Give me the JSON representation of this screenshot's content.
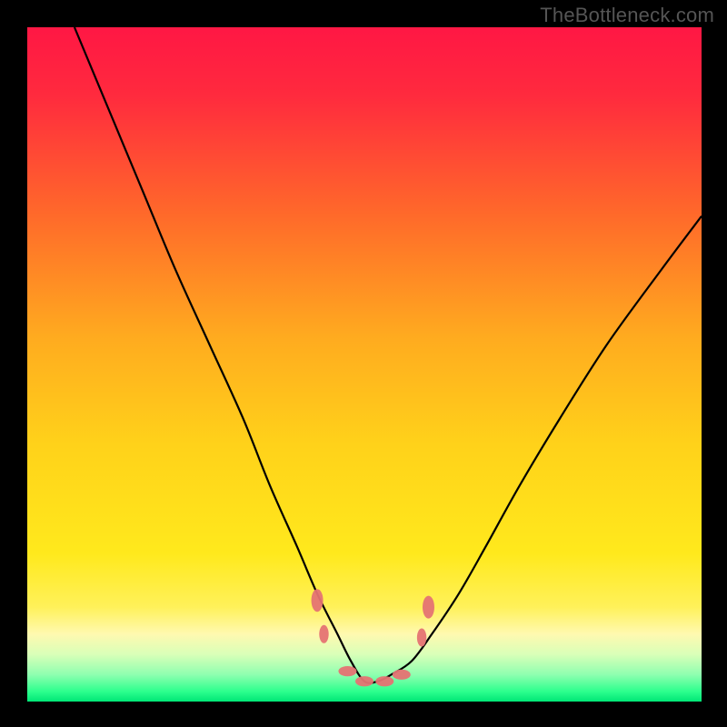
{
  "credit": "TheBottleneck.com",
  "chart_data": {
    "type": "line",
    "title": "",
    "xlabel": "",
    "ylabel": "",
    "xlim": [
      0,
      100
    ],
    "ylim": [
      0,
      100
    ],
    "gradient_stops": [
      {
        "offset": 0.0,
        "color": "#ff1744"
      },
      {
        "offset": 0.1,
        "color": "#ff2a3e"
      },
      {
        "offset": 0.28,
        "color": "#ff6a2a"
      },
      {
        "offset": 0.46,
        "color": "#ffab1f"
      },
      {
        "offset": 0.62,
        "color": "#ffd21a"
      },
      {
        "offset": 0.78,
        "color": "#ffe91c"
      },
      {
        "offset": 0.86,
        "color": "#fff15a"
      },
      {
        "offset": 0.9,
        "color": "#fff9b0"
      },
      {
        "offset": 0.93,
        "color": "#d9ffb8"
      },
      {
        "offset": 0.96,
        "color": "#8fffb0"
      },
      {
        "offset": 0.985,
        "color": "#2dff8d"
      },
      {
        "offset": 1.0,
        "color": "#00e676"
      }
    ],
    "series": [
      {
        "name": "bottleneck-curve",
        "x": [
          7,
          12,
          17,
          22,
          27,
          32,
          36,
          40,
          43,
          46,
          48,
          50,
          52,
          54,
          57,
          60,
          64,
          68,
          73,
          79,
          86,
          94,
          100
        ],
        "y": [
          100,
          88,
          76,
          64,
          53,
          42,
          32,
          23,
          16,
          10,
          6,
          3,
          3,
          4,
          6,
          10,
          16,
          23,
          32,
          42,
          53,
          64,
          72
        ]
      }
    ],
    "markers": [
      {
        "x": 43.0,
        "y": 15.0,
        "r": 10,
        "kind": "ellipse-v"
      },
      {
        "x": 44.0,
        "y": 10.0,
        "r": 8,
        "kind": "ellipse-v"
      },
      {
        "x": 47.5,
        "y": 4.5,
        "r": 8,
        "kind": "ellipse-h"
      },
      {
        "x": 50.0,
        "y": 3.0,
        "r": 8,
        "kind": "ellipse-h"
      },
      {
        "x": 53.0,
        "y": 3.0,
        "r": 8,
        "kind": "ellipse-h"
      },
      {
        "x": 55.5,
        "y": 4.0,
        "r": 8,
        "kind": "ellipse-h"
      },
      {
        "x": 58.5,
        "y": 9.5,
        "r": 8,
        "kind": "ellipse-v"
      },
      {
        "x": 59.5,
        "y": 14.0,
        "r": 10,
        "kind": "ellipse-v"
      }
    ],
    "annotations": []
  }
}
